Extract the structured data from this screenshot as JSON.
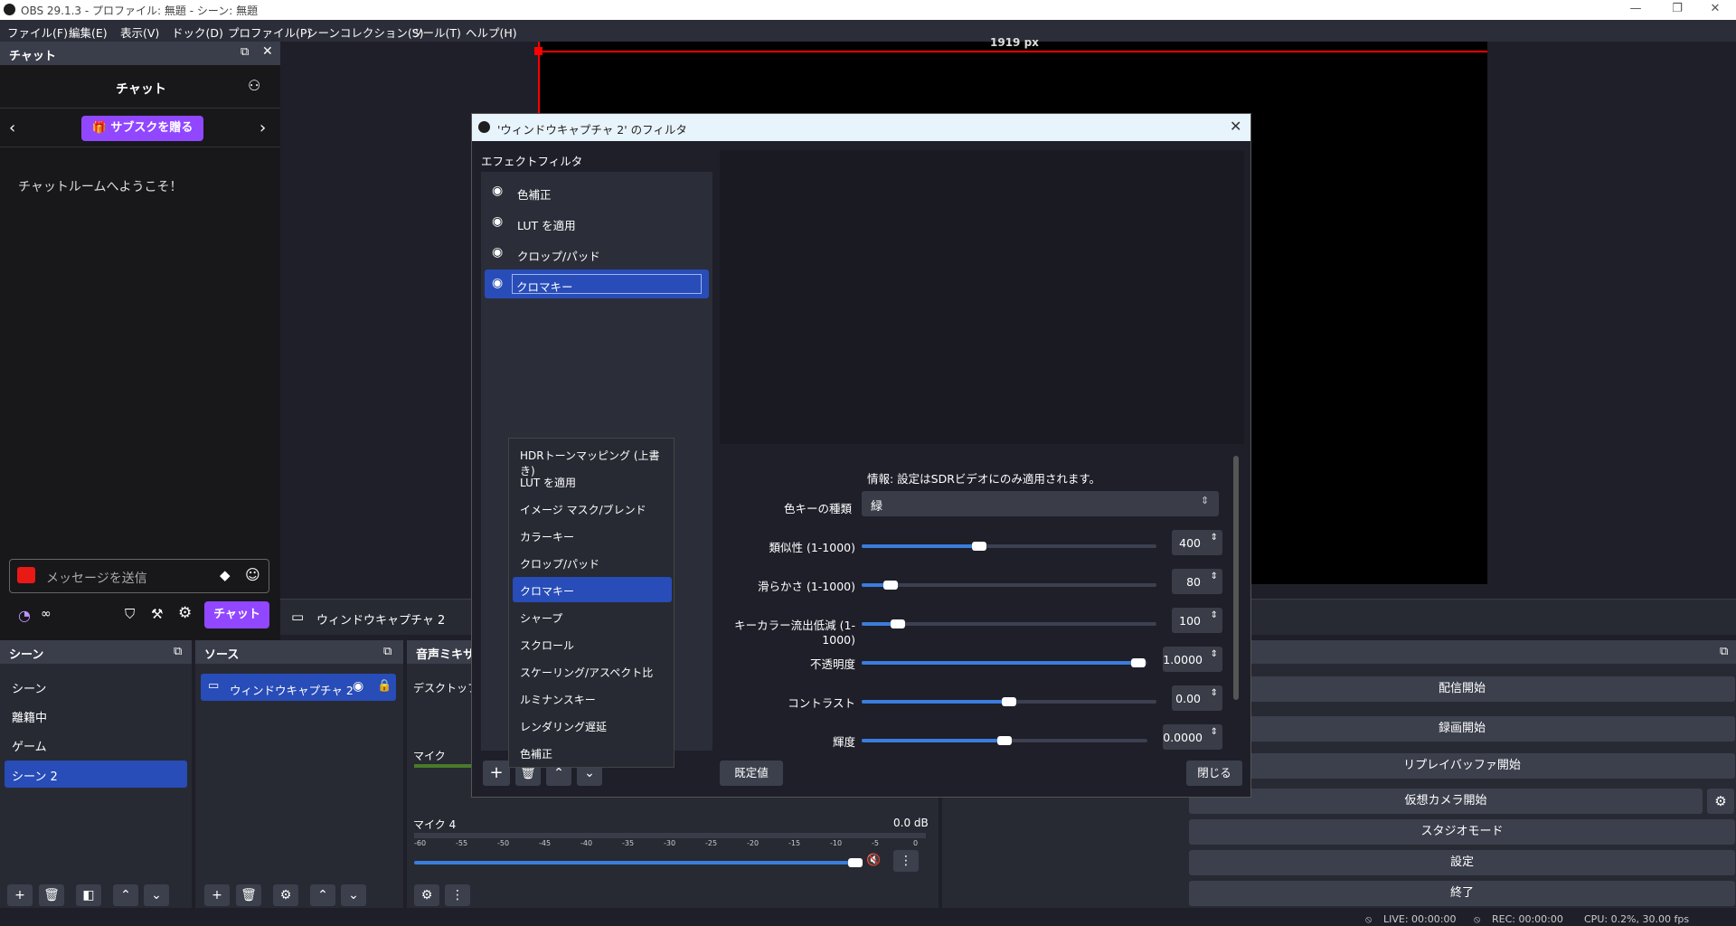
{
  "window": {
    "title": "OBS 29.1.3 - プロファイル: 無題 - シーン: 無題"
  },
  "menu": [
    "ファイル(F)",
    "編集(E)",
    "表示(V)",
    "ドック(D)",
    "プロファイル(P)",
    "シーンコレクション(S)",
    "ツール(T)",
    "ヘルプ(H)"
  ],
  "chat": {
    "dock_title": "チャット",
    "header": "チャット",
    "sub_button": "サブスクを贈る",
    "welcome": "チャットルームへようこそ！",
    "input_placeholder": "メッセージを送信",
    "infinity": "∞",
    "send_button": "チャット"
  },
  "preview": {
    "ruler_label": "1919 px",
    "source_label": "ウィンドウキャプチャ 2"
  },
  "scenes": {
    "title": "シーン",
    "items": [
      "シーン",
      "離籍中",
      "ゲーム",
      "シーン 2"
    ],
    "selected": 3
  },
  "sources": {
    "title": "ソース",
    "items": [
      "ウィンドウキャプチャ 2"
    ]
  },
  "mixer": {
    "title": "音声ミキサー",
    "channels": [
      {
        "name": "デスクトップ音声",
        "db": ""
      },
      {
        "name": "マイク",
        "db": ""
      },
      {
        "name": "マイク 4",
        "db": "0.0 dB"
      }
    ],
    "scale": [
      "-60",
      "-55",
      "-50",
      "-45",
      "-40",
      "-35",
      "-30",
      "-25",
      "-20",
      "-15",
      "-10",
      "-5",
      "0"
    ]
  },
  "controls": {
    "buttons": [
      "配信開始",
      "録画開始",
      "リプレイバッファ開始",
      "仮想カメラ開始",
      "スタジオモード",
      "設定",
      "終了"
    ]
  },
  "status": {
    "live": "LIVE: 00:00:00",
    "rec": "REC: 00:00:00",
    "cpu": "CPU: 0.2%, 30.00 fps"
  },
  "dialog": {
    "title": "'ウィンドウキャプチャ 2' のフィルタ",
    "effects_label": "エフェクトフィルタ",
    "filters": [
      "色補正",
      "LUT を適用",
      "クロップ/パッド",
      "クロマキー"
    ],
    "selected_filter": 3,
    "info": "情報: 設定はSDRビデオにのみ適用されます。",
    "key_color_label": "色キーの種類",
    "key_color_value": "緑",
    "params": [
      {
        "label": "類似性 (1-1000)",
        "value": "400",
        "fraction": 0.4
      },
      {
        "label": "滑らかさ (1-1000)",
        "value": "80",
        "fraction": 0.08
      },
      {
        "label": "キーカラー流出低減 (1-1000)",
        "value": "100",
        "fraction": 0.1
      },
      {
        "label": "不透明度",
        "value": "1.0000",
        "fraction": 1.0
      },
      {
        "label": "コントラスト",
        "value": "0.00",
        "fraction": 0.5
      },
      {
        "label": "輝度",
        "value": "0.0000",
        "fraction": 0.5
      }
    ],
    "defaults_button": "既定値",
    "close_button": "閉じる"
  },
  "filter_menu": {
    "items": [
      "HDRトーンマッピング (上書き)",
      "LUT を適用",
      "イメージ マスク/ブレンド",
      "カラーキー",
      "クロップ/パッド",
      "クロマキー",
      "シャープ",
      "スクロール",
      "スケーリング/アスペクト比",
      "ルミナンスキー",
      "レンダリング遅延",
      "色補正"
    ],
    "highlighted": 5
  },
  "colors": {
    "accent": "#284cb8",
    "twitch": "#9147ff",
    "slider": "#3b7ddd",
    "canvas_border": "#ff0000"
  }
}
